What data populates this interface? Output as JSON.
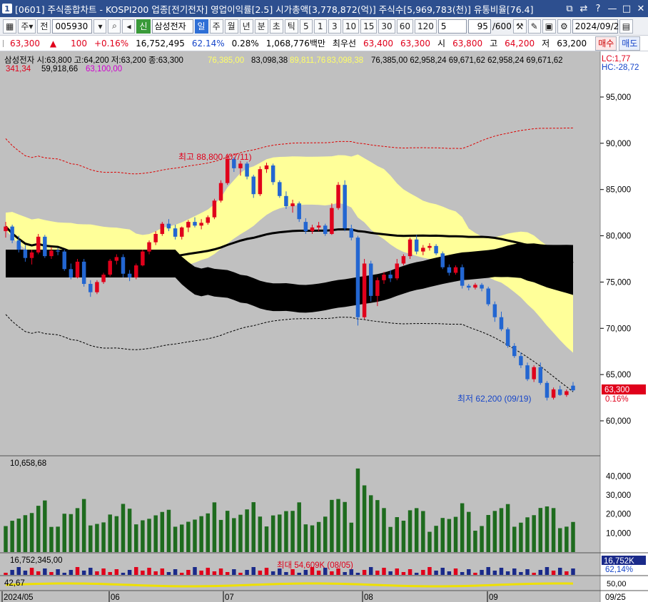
{
  "titlebar": {
    "app_num": "1",
    "title": "[0601] 주식종합차트 - KOSPI200 업종[전기전자] 영업이익률[2.5] 시가총액[3,778,872(억)] 주식수[5,969,783(천)] 유통비율[76.4]"
  },
  "toolbar": {
    "period_select": "주",
    "mode_select": "전",
    "code": "005930",
    "stock_tag": "신",
    "stock_name": "삼성전자",
    "intervals": [
      "일",
      "주",
      "월",
      "년",
      "분",
      "초",
      "틱"
    ],
    "active_interval": "일",
    "minutes": [
      "5",
      "1",
      "3",
      "10",
      "15",
      "30",
      "60",
      "120"
    ],
    "minute_combo": "5",
    "count": "95",
    "count_total": "/600",
    "date": "2024/09/25"
  },
  "quote": {
    "price": "63,300",
    "arrow": "▲",
    "change": "100",
    "change_pct": "+0.16%",
    "volume": "16,752,495",
    "vol_ratio": "62.14%",
    "turnover_pct": "0.28%",
    "amount": "1,068,776백만",
    "best_ask_label": "최우선",
    "best_ask": "63,400",
    "best_bid": "63,300",
    "open_label": "시",
    "open": "63,800",
    "high_label": "고",
    "high": "64,200",
    "low_label": "저",
    "low": "63,200",
    "buy_label": "매수",
    "sell_label": "매도"
  },
  "legend": {
    "ohlc": "삼성전자 시:63,800 고:64,200 저:63,200 종:63,300",
    "bb1": "76,385,00",
    "bb1b": "83,098,38",
    "bb2": "89,811,76",
    "bb2b": "83,098,38",
    "ichi": "76,385,00 62,958,24 69,671,62 62,958,24 69,671,62",
    "ma": "341,34",
    "ma2": "59,918,66",
    "ma3": "63,100,00",
    "lc": "LC:1,77",
    "hc": "HC:-28,72"
  },
  "annotations": {
    "high": "최고 88,800 (07/11)",
    "low": "최저 62,200 (09/19)",
    "vol_max": "최대 54,609K (08/05)"
  },
  "price_axis": [
    "95,000",
    "90,000",
    "85,000",
    "80,000",
    "75,000",
    "70,000",
    "65,000",
    "60,000"
  ],
  "current_price_tag": "63,300",
  "current_pct": "0.16%",
  "volume_panel": {
    "label": "10,658,68",
    "ticks": [
      "40,000",
      "30,000",
      "20,000",
      "10,000"
    ]
  },
  "sub_panel": {
    "label": "16,752,345,00",
    "tag1": "16,752K",
    "tag2": "62,14%"
  },
  "osc_panel": {
    "label": "42,67",
    "ticks": [
      "50,00",
      "-50,00"
    ]
  },
  "date_axis": [
    "2024/05",
    "06",
    "07",
    "08",
    "09",
    "09/25"
  ],
  "colors": {
    "up": "#e0001b",
    "down": "#2366d1",
    "bb_fill": "#ffff99",
    "cloud": "#000000",
    "vol": "#1e6b1e"
  },
  "chart_data": {
    "type": "candlestick",
    "x_range_hint": "2024/05 to 09/25",
    "candles": [
      [
        80500,
        81500,
        79800,
        81000
      ],
      [
        81000,
        81200,
        79200,
        79500
      ],
      [
        79500,
        80000,
        78200,
        78500
      ],
      [
        78500,
        79000,
        77200,
        77600
      ],
      [
        77600,
        78500,
        76900,
        78200
      ],
      [
        78200,
        80200,
        78000,
        79900
      ],
      [
        79900,
        80100,
        77600,
        77800
      ],
      [
        77800,
        78800,
        77500,
        78400
      ],
      [
        78400,
        78700,
        77900,
        78300
      ],
      [
        78300,
        78500,
        76200,
        76400
      ],
      [
        76400,
        77000,
        75300,
        75500
      ],
      [
        75500,
        77500,
        75400,
        77200
      ],
      [
        77200,
        77500,
        74500,
        74800
      ],
      [
        74800,
        75200,
        73400,
        73900
      ],
      [
        73900,
        75200,
        73700,
        75000
      ],
      [
        75000,
        76000,
        74800,
        75800
      ],
      [
        75800,
        77500,
        75600,
        77300
      ],
      [
        77300,
        78000,
        76900,
        77700
      ],
      [
        77700,
        78000,
        75500,
        75900
      ],
      [
        75900,
        76300,
        75100,
        75500
      ],
      [
        75500,
        77000,
        75300,
        76800
      ],
      [
        76800,
        78500,
        76700,
        78300
      ],
      [
        78300,
        79500,
        78000,
        79300
      ],
      [
        79300,
        80500,
        79000,
        80200
      ],
      [
        80200,
        81500,
        80000,
        81300
      ],
      [
        81300,
        81800,
        80500,
        80800
      ],
      [
        80800,
        81200,
        79600,
        79900
      ],
      [
        79900,
        81000,
        79600,
        80900
      ],
      [
        80900,
        81700,
        80400,
        81500
      ],
      [
        81500,
        82000,
        80900,
        81100
      ],
      [
        81100,
        81800,
        80700,
        81400
      ],
      [
        81400,
        82200,
        81200,
        82000
      ],
      [
        82000,
        84000,
        81800,
        83800
      ],
      [
        83800,
        86000,
        83600,
        85700
      ],
      [
        85700,
        88800,
        85500,
        88300
      ],
      [
        88300,
        88500,
        86900,
        87300
      ],
      [
        87300,
        88100,
        86500,
        87800
      ],
      [
        87800,
        88000,
        86100,
        86400
      ],
      [
        86400,
        86600,
        84100,
        84500
      ],
      [
        84500,
        87500,
        84300,
        87200
      ],
      [
        87200,
        87900,
        86800,
        87600
      ],
      [
        87600,
        87800,
        85500,
        85800
      ],
      [
        85800,
        86000,
        84100,
        84300
      ],
      [
        84300,
        84800,
        82900,
        83200
      ],
      [
        83200,
        83900,
        82500,
        83500
      ],
      [
        83500,
        83700,
        81500,
        81800
      ],
      [
        81500,
        81900,
        80200,
        80500
      ],
      [
        80500,
        81200,
        80200,
        80900
      ],
      [
        80900,
        81500,
        80500,
        81100
      ],
      [
        81100,
        81300,
        80000,
        80200
      ],
      [
        80200,
        83500,
        80100,
        83000
      ],
      [
        83000,
        85800,
        82800,
        85500
      ],
      [
        85500,
        86000,
        80500,
        80800
      ],
      [
        80800,
        81200,
        79500,
        79800
      ],
      [
        79800,
        80000,
        70300,
        71200
      ],
      [
        71200,
        77500,
        71000,
        77000
      ],
      [
        77000,
        77300,
        72900,
        73500
      ],
      [
        73500,
        75500,
        72400,
        75200
      ],
      [
        75200,
        76100,
        74800,
        75800
      ],
      [
        75800,
        76300,
        75000,
        75400
      ],
      [
        75400,
        77500,
        75200,
        77000
      ],
      [
        77000,
        78000,
        76800,
        77800
      ],
      [
        77800,
        79800,
        77500,
        79600
      ],
      [
        79600,
        80100,
        78000,
        78300
      ],
      [
        78300,
        79000,
        77900,
        78700
      ],
      [
        78700,
        79200,
        78400,
        78900
      ],
      [
        78900,
        79100,
        77900,
        78100
      ],
      [
        78100,
        78300,
        76400,
        76600
      ],
      [
        76600,
        76900,
        75700,
        76000
      ],
      [
        76000,
        76800,
        75800,
        76600
      ],
      [
        76600,
        76900,
        74300,
        74600
      ],
      [
        74600,
        74800,
        74100,
        74400
      ],
      [
        74400,
        74900,
        74200,
        74700
      ],
      [
        74700,
        74900,
        74000,
        74300
      ],
      [
        74300,
        74500,
        72400,
        72600
      ],
      [
        72600,
        72900,
        70700,
        71200
      ],
      [
        71200,
        71800,
        69700,
        69900
      ],
      [
        69900,
        70100,
        67900,
        68100
      ],
      [
        68100,
        68400,
        66800,
        67000
      ],
      [
        67000,
        67400,
        65700,
        66000
      ],
      [
        66000,
        66300,
        64300,
        64500
      ],
      [
        64500,
        66000,
        64200,
        65800
      ],
      [
        65800,
        66300,
        63900,
        64100
      ],
      [
        64100,
        64300,
        62200,
        62500
      ],
      [
        62500,
        63600,
        62300,
        63400
      ],
      [
        63400,
        63800,
        62700,
        62800
      ],
      [
        62800,
        63400,
        62600,
        63200
      ],
      [
        63800,
        64200,
        63200,
        63300
      ]
    ]
  }
}
